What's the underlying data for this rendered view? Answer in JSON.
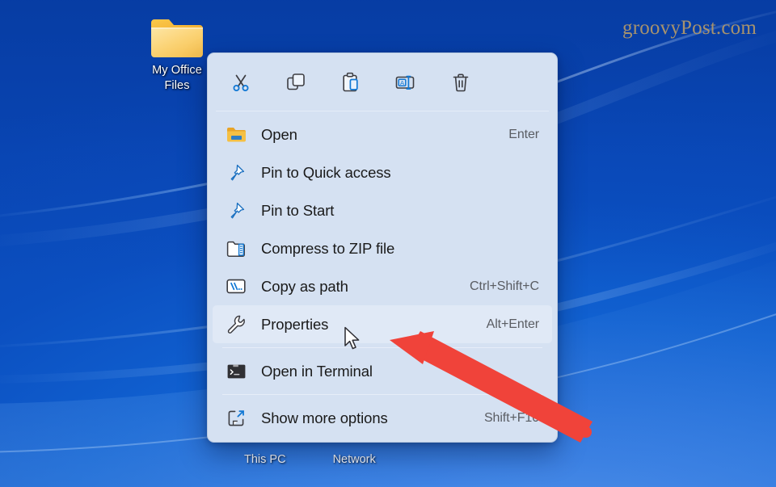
{
  "desktop": {
    "wallpaper_color": "#0c54c6",
    "watermark": "groovyPost.com",
    "icons": [
      {
        "name": "My Office Files",
        "label_line1": "My Office",
        "label_line2": "Files",
        "icon": "folder-icon"
      }
    ],
    "bottom_icon_labels": [
      "This PC",
      "Network"
    ]
  },
  "context_menu": {
    "toolbar": [
      {
        "name": "cut",
        "icon": "scissors-icon",
        "tooltip": "Cut"
      },
      {
        "name": "copy",
        "icon": "copy-icon",
        "tooltip": "Copy"
      },
      {
        "name": "paste",
        "icon": "clipboard-paste-icon",
        "tooltip": "Paste"
      },
      {
        "name": "rename",
        "icon": "rename-icon",
        "tooltip": "Rename"
      },
      {
        "name": "delete",
        "icon": "trash-icon",
        "tooltip": "Delete"
      }
    ],
    "items": [
      {
        "label": "Open",
        "accel": "Enter",
        "icon": "folder-open-icon",
        "selected": false,
        "separator_after": false
      },
      {
        "label": "Pin to Quick access",
        "accel": "",
        "icon": "pin-icon",
        "selected": false,
        "separator_after": false
      },
      {
        "label": "Pin to Start",
        "accel": "",
        "icon": "pin-icon",
        "selected": false,
        "separator_after": false
      },
      {
        "label": "Compress to ZIP file",
        "accel": "",
        "icon": "zip-folder-icon",
        "selected": false,
        "separator_after": false
      },
      {
        "label": "Copy as path",
        "accel": "Ctrl+Shift+C",
        "icon": "copy-path-icon",
        "selected": false,
        "separator_after": false
      },
      {
        "label": "Properties",
        "accel": "Alt+Enter",
        "icon": "wrench-icon",
        "selected": true,
        "separator_after": true
      },
      {
        "label": "Open in Terminal",
        "accel": "",
        "icon": "terminal-icon",
        "selected": false,
        "separator_after": true
      },
      {
        "label": "Show more options",
        "accel": "Shift+F10",
        "icon": "expand-arrow-icon",
        "selected": false,
        "separator_after": false
      }
    ],
    "colors": {
      "background": "#d5e1f2",
      "selected_row": "#e0e9f6",
      "text": "#1a1a1a",
      "accel_text": "#5a5d63",
      "accent": "#0f6cbd"
    }
  },
  "annotation": {
    "arrow_color": "#f0433a",
    "arrow_points_at": "Properties",
    "cursor": "arrow-pointer"
  }
}
